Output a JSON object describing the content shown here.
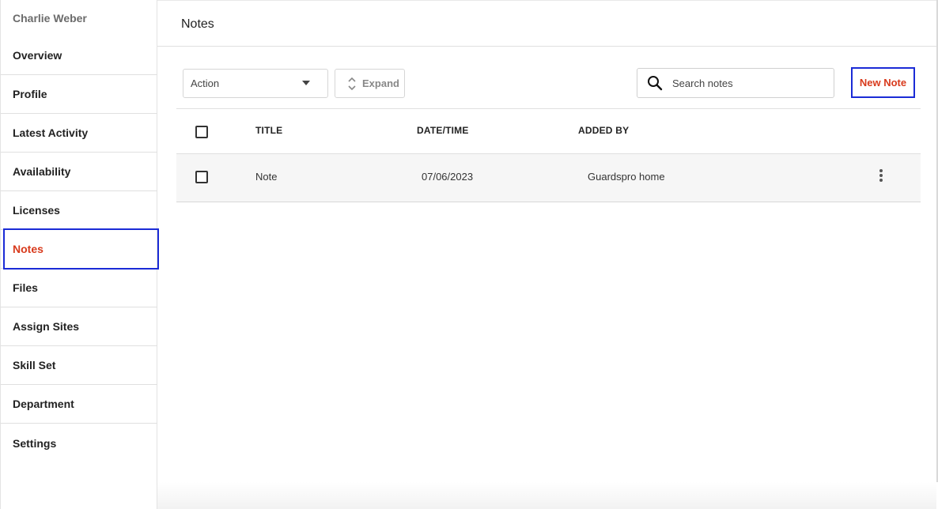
{
  "sidebar": {
    "user_name": "Charlie Weber",
    "items": [
      {
        "label": "Overview",
        "active": false
      },
      {
        "label": "Profile",
        "active": false
      },
      {
        "label": "Latest Activity",
        "active": false
      },
      {
        "label": "Availability",
        "active": false
      },
      {
        "label": "Licenses",
        "active": false
      },
      {
        "label": "Notes",
        "active": true
      },
      {
        "label": "Files",
        "active": false
      },
      {
        "label": "Assign Sites",
        "active": false
      },
      {
        "label": "Skill Set",
        "active": false
      },
      {
        "label": "Department",
        "active": false
      },
      {
        "label": "Settings",
        "active": false
      }
    ]
  },
  "header": {
    "title": "Notes"
  },
  "toolbar": {
    "action_label": "Action",
    "expand_label": "Expand",
    "search_placeholder": "Search notes",
    "search_value": "",
    "new_note_label": "New Note"
  },
  "table": {
    "columns": [
      "TITLE",
      "DATE/TIME",
      "ADDED BY"
    ],
    "rows": [
      {
        "title": "Note",
        "date": "07/06/2023",
        "added_by": "Guardspro home",
        "checked": false
      }
    ]
  },
  "colors": {
    "accent": "#d83a1c",
    "highlight": "#1b2bd6"
  }
}
